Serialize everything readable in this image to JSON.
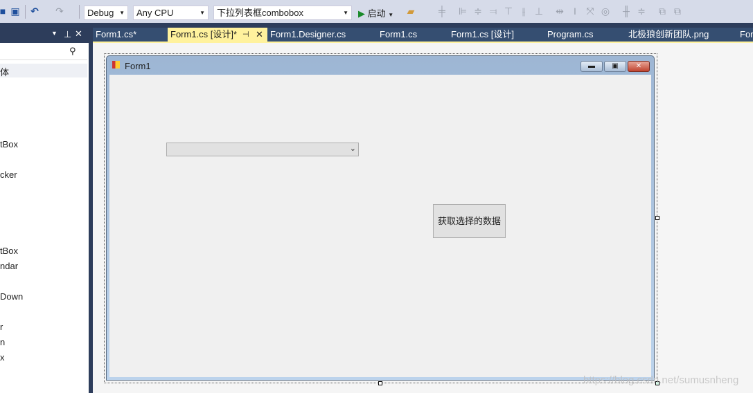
{
  "toolbar": {
    "config": "Debug",
    "platform": "Any CPU",
    "project": "下拉列表框combobox",
    "start_label": "启动"
  },
  "left_panel": {
    "items": [
      "体",
      "tBox",
      "cker",
      "tBox",
      "ndar",
      "Down",
      "r",
      "n",
      "x"
    ]
  },
  "tabs": [
    {
      "label": "Form1.cs*"
    },
    {
      "label": "Form1.cs [设计]*",
      "active": true
    },
    {
      "label": "Form1.Designer.cs"
    },
    {
      "label": "Form1.cs"
    },
    {
      "label": "Form1.cs [设计]"
    },
    {
      "label": "Program.cs"
    },
    {
      "label": "北极狼创新团队.png"
    },
    {
      "label": "For"
    }
  ],
  "form": {
    "title": "Form1",
    "button_label": "获取选择的数据",
    "combobox_value": ""
  },
  "watermark": "https://blog.csdn.net/sumusnheng",
  "colors": {
    "accent_tab": "#fff29d",
    "chrome_dark": "#2d3d5b"
  }
}
